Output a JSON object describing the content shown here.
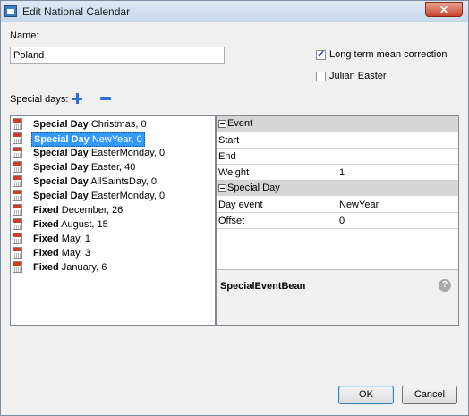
{
  "window": {
    "title": "Edit National Calendar",
    "close_glyph": "✕"
  },
  "name": {
    "label": "Name:",
    "value": "Poland"
  },
  "options": [
    {
      "label": "Long term mean correction",
      "checked": true
    },
    {
      "label": "Julian Easter",
      "checked": false
    }
  ],
  "special_days": {
    "label": "Special days:",
    "items": [
      {
        "kind": "Special Day",
        "detail": "Christmas, 0"
      },
      {
        "kind": "Special Day",
        "detail": "NewYear, 0",
        "selected": true
      },
      {
        "kind": "Special Day",
        "detail": "EasterMonday, 0"
      },
      {
        "kind": "Special Day",
        "detail": "Easter, 40"
      },
      {
        "kind": "Special Day",
        "detail": "AllSaintsDay, 0"
      },
      {
        "kind": "Special Day",
        "detail": "EasterMonday, 0"
      },
      {
        "kind": "Fixed",
        "detail": "December, 26"
      },
      {
        "kind": "Fixed",
        "detail": "August, 15"
      },
      {
        "kind": "Fixed",
        "detail": "May, 1"
      },
      {
        "kind": "Fixed",
        "detail": "May, 3"
      },
      {
        "kind": "Fixed",
        "detail": "January, 6"
      }
    ]
  },
  "properties": {
    "sections": [
      {
        "title": "Event",
        "rows": [
          {
            "name": "Start",
            "value": ""
          },
          {
            "name": "End",
            "value": ""
          },
          {
            "name": "Weight",
            "value": "1"
          }
        ]
      },
      {
        "title": "Special Day",
        "rows": [
          {
            "name": "Day event",
            "value": "NewYear"
          },
          {
            "name": "Offset",
            "value": "0"
          }
        ]
      }
    ],
    "description_title": "SpecialEventBean",
    "help_glyph": "?"
  },
  "buttons": {
    "ok": "OK",
    "cancel": "Cancel"
  }
}
